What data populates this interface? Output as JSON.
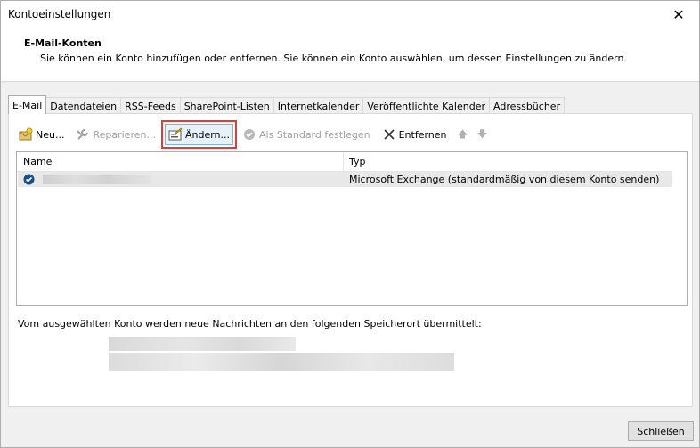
{
  "window": {
    "title": "Kontoeinstellungen",
    "close_glyph": "✕"
  },
  "header": {
    "title": "E-Mail-Konten",
    "description": "Sie können ein Konto hinzufügen oder entfernen. Sie können ein Konto auswählen, um dessen Einstellungen zu ändern."
  },
  "tabs": [
    {
      "label": "E-Mail",
      "active": true
    },
    {
      "label": "Datendateien"
    },
    {
      "label": "RSS-Feeds"
    },
    {
      "label": "SharePoint-Listen"
    },
    {
      "label": "Internetkalender"
    },
    {
      "label": "Veröffentlichte Kalender"
    },
    {
      "label": "Adressbücher"
    }
  ],
  "toolbar": {
    "new_label": "Neu...",
    "repair_label": "Reparieren...",
    "change_label": "Ändern...",
    "default_label": "Als Standard festlegen",
    "remove_label": "Entfernen",
    "up_glyph": "🡅",
    "down_glyph": "🡇"
  },
  "list": {
    "columns": [
      "Name",
      "Typ"
    ],
    "rows": [
      {
        "type": "Microsoft Exchange (standardmäßig von diesem Konto senden)"
      }
    ]
  },
  "footer": {
    "delivery_text": "Vom ausgewählten Konto werden neue Nachrichten an den folgenden Speicherort übermittelt:"
  },
  "buttons": {
    "close_label": "Schließen"
  },
  "colors": {
    "highlight": "#e03c3c",
    "accent": "#1b4f8a"
  }
}
